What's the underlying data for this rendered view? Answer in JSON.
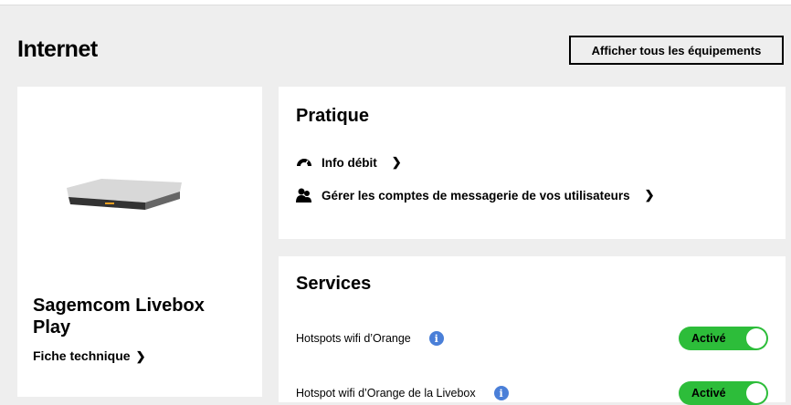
{
  "header": {
    "title": "Internet",
    "show_all_button": "Afficher tous les équipements"
  },
  "device": {
    "name": "Sagemcom Livebox Play",
    "spec_link": "Fiche technique"
  },
  "pratique": {
    "title": "Pratique",
    "links": [
      {
        "label": "Info débit",
        "icon": "speedometer-icon"
      },
      {
        "label": "Gérer les comptes de messagerie de vos utilisateurs",
        "icon": "users-icon"
      }
    ]
  },
  "services": {
    "title": "Services",
    "items": [
      {
        "label": "Hotspots wifi d’Orange",
        "status": "Activé"
      },
      {
        "label": "Hotspot wifi d’Orange de la Livebox",
        "status": "Activé"
      }
    ]
  },
  "colors": {
    "toggle_on": "#2dbd3a",
    "info": "#4a7fd8"
  }
}
